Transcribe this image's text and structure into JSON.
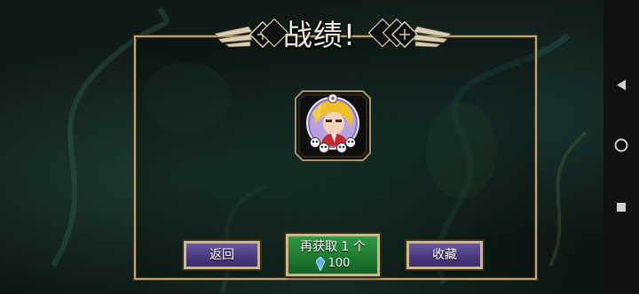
{
  "screen": {
    "title": "战绩!"
  },
  "buttons": {
    "back_label": "返回",
    "retry_label": "再获取 1 个",
    "retry_cost": "100",
    "favorite_label": "收藏"
  },
  "icons": {
    "portrait": "character-portrait-icon",
    "skulls": "skull-icon",
    "gem": "blue-crystal-icon",
    "nav_back": "triangle-back-icon",
    "nav_home": "circle-home-icon",
    "nav_recent": "square-recent-icon"
  },
  "colors": {
    "frame_gold": "#b9a574",
    "button_purple": "#5a4690",
    "button_green": "#238a38"
  }
}
